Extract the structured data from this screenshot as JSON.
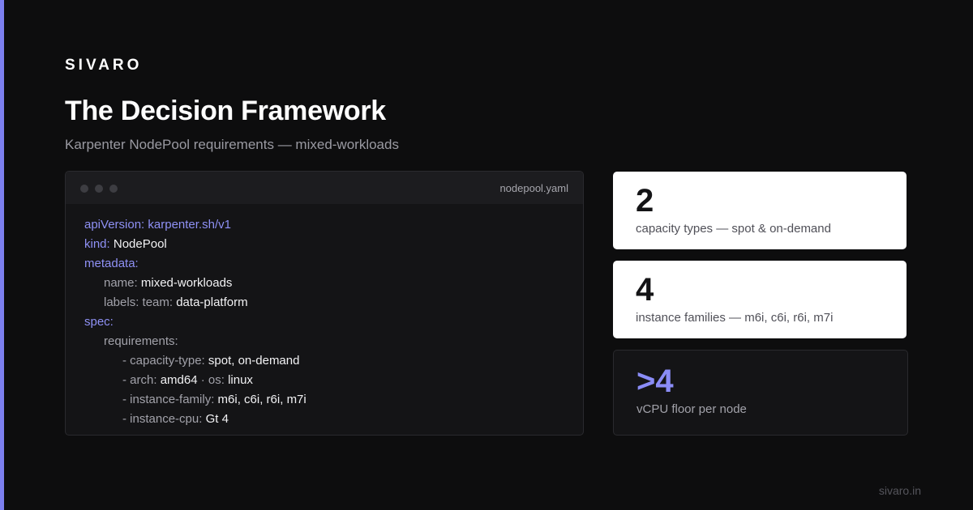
{
  "brand": "SIVARO",
  "title": "The Decision Framework",
  "subtitle": "Karpenter NodePool requirements — mixed-workloads",
  "code_window": {
    "filename": "nodepool.yaml",
    "lines": [
      {
        "indent": 0,
        "key": "apiVersion:",
        "value": "karpenter.sh/v1",
        "key_style": "accent",
        "value_style": "accent"
      },
      {
        "indent": 0,
        "key": "kind:",
        "value": "NodePool",
        "key_style": "accent",
        "value_style": "plain"
      },
      {
        "indent": 0,
        "key": "metadata:",
        "value": "",
        "key_style": "accent",
        "value_style": "plain"
      },
      {
        "indent": 1,
        "key": "name:",
        "value": "mixed-workloads",
        "key_style": "muted",
        "value_style": "plain"
      },
      {
        "indent": 1,
        "key": "labels: team:",
        "value": "data-platform",
        "key_style": "muted",
        "value_style": "plain"
      },
      {
        "indent": 0,
        "key": "spec:",
        "value": "",
        "key_style": "accent",
        "value_style": "plain"
      },
      {
        "indent": 1,
        "key": "requirements:",
        "value": "",
        "key_style": "muted",
        "value_style": "plain"
      },
      {
        "indent": 2,
        "key": "- capacity-type:",
        "value": "spot, on-demand",
        "key_style": "muted",
        "value_style": "plain"
      },
      {
        "indent": 2,
        "key": "- arch:",
        "value": "amd64",
        "key_style": "muted",
        "value_style": "plain",
        "extra_key": " · os:",
        "extra_value": "linux"
      },
      {
        "indent": 2,
        "key": "- instance-family:",
        "value": "m6i, c6i, r6i, m7i",
        "key_style": "muted",
        "value_style": "plain"
      },
      {
        "indent": 2,
        "key": "- instance-cpu:",
        "value": "Gt 4",
        "key_style": "muted",
        "value_style": "plain"
      }
    ]
  },
  "stats": [
    {
      "value": "2",
      "label": "capacity types — spot & on-demand"
    },
    {
      "value": "4",
      "label": "instance families — m6i, c6i, r6i, m7i"
    },
    {
      "value": ">4",
      "label": "vCPU floor per node"
    }
  ],
  "footer": "sivaro.in",
  "colors": {
    "accent": "#7c7fef",
    "background": "#0d0d0e",
    "card_light": "#ffffff",
    "card_dark": "#141416"
  }
}
